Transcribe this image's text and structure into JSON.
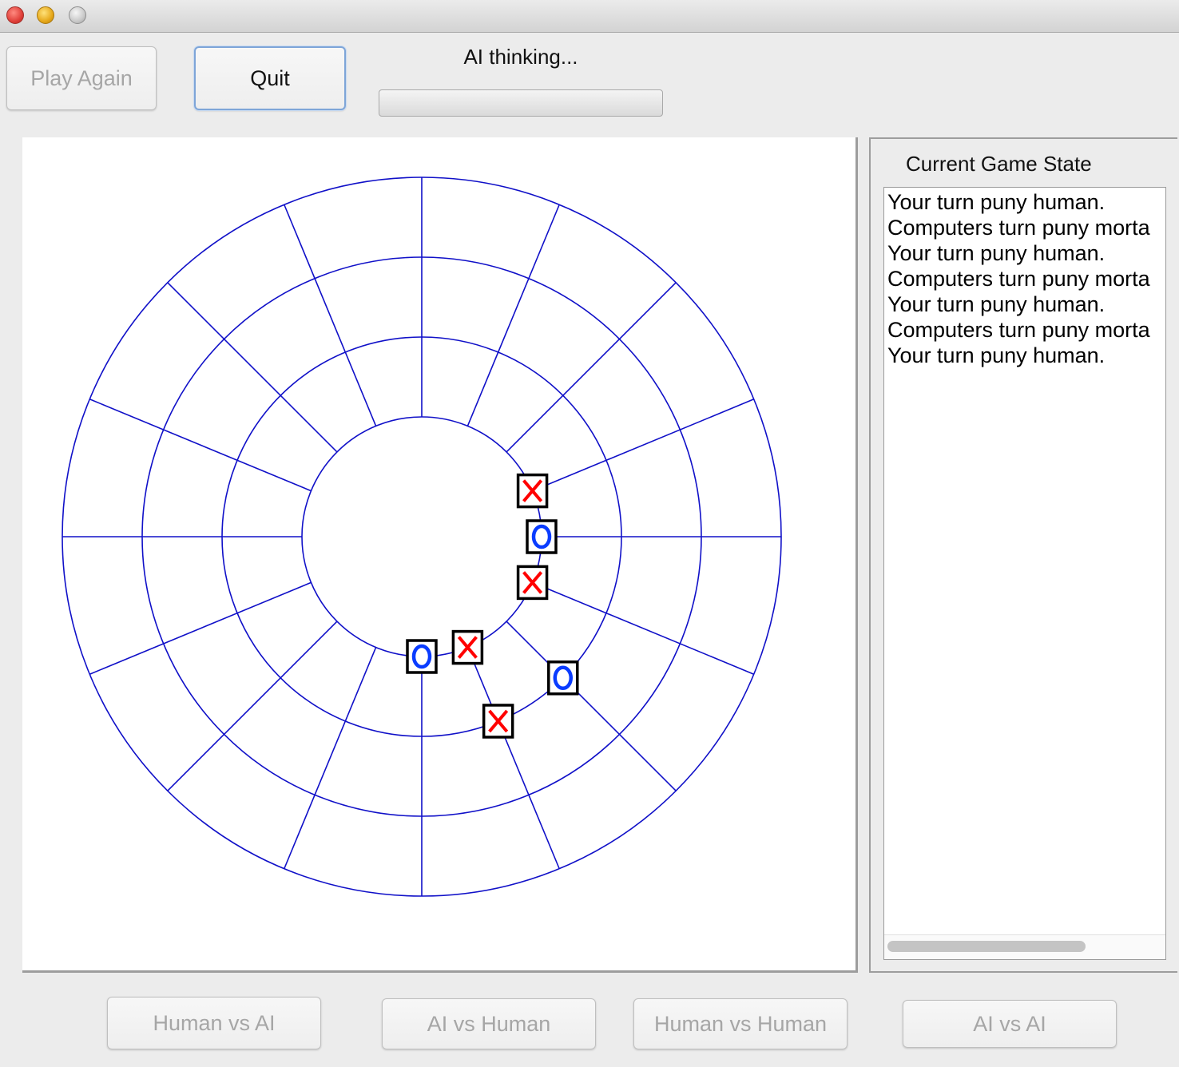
{
  "window": {
    "title": ""
  },
  "toolbar": {
    "play_again_label": "Play Again",
    "quit_label": "Quit",
    "status_text": "AI thinking...",
    "progress": 0
  },
  "board": {
    "rings": 4,
    "sectors": 16,
    "line_color": "#1010c8",
    "pieces": [
      {
        "mark": "X",
        "ring": 1,
        "sector": 1
      },
      {
        "mark": "O",
        "ring": 1,
        "sector": 0
      },
      {
        "mark": "X",
        "ring": 1,
        "sector": 15
      },
      {
        "mark": "O",
        "ring": 2,
        "sector": 14
      },
      {
        "mark": "X",
        "ring": 1,
        "sector": 13
      },
      {
        "mark": "O",
        "ring": 1,
        "sector": 12
      },
      {
        "mark": "X",
        "ring": 2,
        "sector": 13
      }
    ],
    "x_color": "#ff0000",
    "o_color": "#0a3cff"
  },
  "side_panel": {
    "title": "Current Game State",
    "log": [
      "Your turn puny human.",
      "Computers turn puny morta",
      "Your turn puny human.",
      "Computers turn puny morta",
      "Your turn puny human.",
      "Computers turn puny morta",
      "Your turn puny human."
    ]
  },
  "modes": {
    "human_vs_ai": "Human vs AI",
    "ai_vs_human": "AI vs Human",
    "human_vs_human": "Human vs Human",
    "ai_vs_ai": "AI vs AI"
  }
}
